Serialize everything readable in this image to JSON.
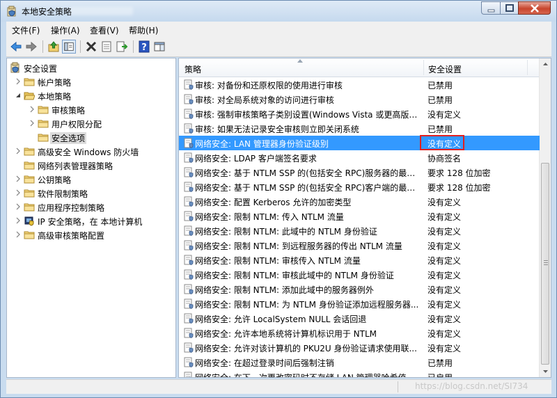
{
  "window": {
    "title": "本地安全策略",
    "controls": [
      "minimize",
      "maximize",
      "close"
    ]
  },
  "menu": [
    "文件(F)",
    "操作(A)",
    "查看(V)",
    "帮助(H)"
  ],
  "toolbar": [
    "back-icon",
    "forward-icon",
    "up-folder-icon",
    "show-hide-tree-icon",
    "delete-icon",
    "properties-icon",
    "export-list-icon",
    "help-icon",
    "show-pane-icon"
  ],
  "tree": [
    {
      "label": "安全设置",
      "icon": "security-settings-icon",
      "level": 0,
      "expander": "none"
    },
    {
      "label": "帐户策略",
      "icon": "folder-icon",
      "level": 1,
      "expander": "collapsed"
    },
    {
      "label": "本地策略",
      "icon": "folder-open-icon",
      "level": 1,
      "expander": "expanded"
    },
    {
      "label": "审核策略",
      "icon": "folder-icon",
      "level": 2,
      "expander": "collapsed"
    },
    {
      "label": "用户权限分配",
      "icon": "folder-icon",
      "level": 2,
      "expander": "collapsed"
    },
    {
      "label": "安全选项",
      "icon": "folder-icon",
      "level": 2,
      "expander": "none",
      "selected": true
    },
    {
      "label": "高级安全 Windows 防火墙",
      "icon": "folder-icon",
      "level": 1,
      "expander": "collapsed"
    },
    {
      "label": "网络列表管理器策略",
      "icon": "folder-icon",
      "level": 1,
      "expander": "none"
    },
    {
      "label": "公钥策略",
      "icon": "folder-icon",
      "level": 1,
      "expander": "collapsed"
    },
    {
      "label": "软件限制策略",
      "icon": "folder-icon",
      "level": 1,
      "expander": "collapsed"
    },
    {
      "label": "应用程序控制策略",
      "icon": "folder-icon",
      "level": 1,
      "expander": "collapsed"
    },
    {
      "label": "IP 安全策略，在 本地计算机",
      "icon": "ip-security-icon",
      "level": 1,
      "expander": "collapsed"
    },
    {
      "label": "高级审核策略配置",
      "icon": "folder-icon",
      "level": 1,
      "expander": "collapsed"
    }
  ],
  "table": {
    "columns": [
      "策略",
      "安全设置"
    ],
    "rows": [
      {
        "policy": "审核: 对备份和还原权限的使用进行审核",
        "setting": "已禁用"
      },
      {
        "policy": "审核: 对全局系统对象的访问进行审核",
        "setting": "已禁用"
      },
      {
        "policy": "审核: 强制审核策略子类别设置(Windows Vista 或更高版本...",
        "setting": "没有定义"
      },
      {
        "policy": "审核: 如果无法记录安全审核则立即关闭系统",
        "setting": "已禁用"
      },
      {
        "policy": "网络安全: LAN 管理器身份验证级别",
        "setting": "没有定义",
        "selected": true,
        "highlighted": true
      },
      {
        "policy": "网络安全: LDAP 客户端签名要求",
        "setting": "协商签名"
      },
      {
        "policy": "网络安全: 基于 NTLM SSP 的(包括安全 RPC)服务器的最小...",
        "setting": "要求 128 位加密"
      },
      {
        "policy": "网络安全: 基于 NTLM SSP 的(包括安全 RPC)客户端的最小...",
        "setting": "要求 128 位加密"
      },
      {
        "policy": "网络安全: 配置 Kerberos 允许的加密类型",
        "setting": "没有定义"
      },
      {
        "policy": "网络安全: 限制 NTLM: 传入 NTLM 流量",
        "setting": "没有定义"
      },
      {
        "policy": "网络安全: 限制 NTLM: 此域中的 NTLM 身份验证",
        "setting": "没有定义"
      },
      {
        "policy": "网络安全: 限制 NTLM: 到远程服务器的传出 NTLM 流量",
        "setting": "没有定义"
      },
      {
        "policy": "网络安全: 限制 NTLM: 审核传入 NTLM 流量",
        "setting": "没有定义"
      },
      {
        "policy": "网络安全: 限制 NTLM: 审核此域中的 NTLM 身份验证",
        "setting": "没有定义"
      },
      {
        "policy": "网络安全: 限制 NTLM: 添加此域中的服务器例外",
        "setting": "没有定义"
      },
      {
        "policy": "网络安全: 限制 NTLM: 为 NTLM 身份验证添加远程服务器...",
        "setting": "没有定义"
      },
      {
        "policy": "网络安全: 允许 LocalSystem NULL 会话回退",
        "setting": "没有定义"
      },
      {
        "policy": "网络安全: 允许本地系统将计算机标识用于 NTLM",
        "setting": "没有定义"
      },
      {
        "policy": "网络安全: 允许对该计算机的 PKU2U 身份验证请求使用联...",
        "setting": "没有定义"
      },
      {
        "policy": "网络安全: 在超过登录时间后强制注销",
        "setting": "已禁用"
      },
      {
        "policy": "网络安全: 在下一次更改密码时不存储 LAN 管理器哈希值",
        "setting": "已启用"
      }
    ]
  },
  "watermark": "https://blog.csdn.net/SI734",
  "colors": {
    "selection": "#3399ff",
    "highlight_box": "#e02020",
    "title_bar": "#c5d9ee",
    "close_button": "#c8452d"
  }
}
